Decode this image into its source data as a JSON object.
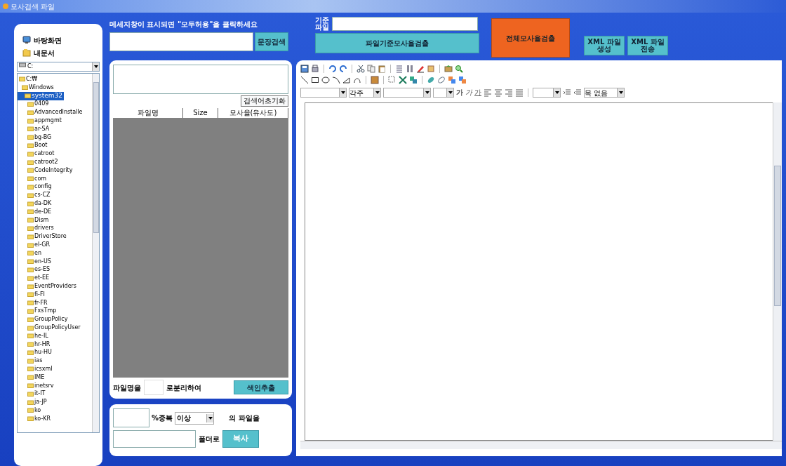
{
  "window": {
    "title": "모사검색 파일"
  },
  "shortcuts": [
    {
      "label": "바탕화면",
      "kind": "desktop"
    },
    {
      "label": "내문서",
      "kind": "documents"
    }
  ],
  "drive": {
    "value": "C:"
  },
  "tree": [
    {
      "label": "C:₩",
      "selected": false,
      "children": [
        {
          "label": "Windows",
          "selected": false,
          "children": [
            {
              "label": "system32",
              "selected": true,
              "children": [
                {
                  "label": "0409",
                  "selected": false
                },
                {
                  "label": "AdvancedInstalle",
                  "selected": false
                },
                {
                  "label": "appmgmt",
                  "selected": false
                },
                {
                  "label": "ar-SA",
                  "selected": false
                },
                {
                  "label": "bg-BG",
                  "selected": false
                },
                {
                  "label": "Boot",
                  "selected": false
                },
                {
                  "label": "catroot",
                  "selected": false
                },
                {
                  "label": "catroot2",
                  "selected": false
                },
                {
                  "label": "CodeIntegrity",
                  "selected": false
                },
                {
                  "label": "com",
                  "selected": false
                },
                {
                  "label": "config",
                  "selected": false
                },
                {
                  "label": "cs-CZ",
                  "selected": false
                },
                {
                  "label": "da-DK",
                  "selected": false
                },
                {
                  "label": "de-DE",
                  "selected": false
                },
                {
                  "label": "Dism",
                  "selected": false
                },
                {
                  "label": "drivers",
                  "selected": false
                },
                {
                  "label": "DriverStore",
                  "selected": false
                },
                {
                  "label": "el-GR",
                  "selected": false
                },
                {
                  "label": "en",
                  "selected": false
                },
                {
                  "label": "en-US",
                  "selected": false
                },
                {
                  "label": "es-ES",
                  "selected": false
                },
                {
                  "label": "et-EE",
                  "selected": false
                },
                {
                  "label": "EventProviders",
                  "selected": false
                },
                {
                  "label": "fi-FI",
                  "selected": false
                },
                {
                  "label": "fr-FR",
                  "selected": false
                },
                {
                  "label": "FxsTmp",
                  "selected": false
                },
                {
                  "label": "GroupPolicy",
                  "selected": false
                },
                {
                  "label": "GroupPolicyUser",
                  "selected": false
                },
                {
                  "label": "he-IL",
                  "selected": false
                },
                {
                  "label": "hr-HR",
                  "selected": false
                },
                {
                  "label": "hu-HU",
                  "selected": false
                },
                {
                  "label": "ias",
                  "selected": false
                },
                {
                  "label": "icsxml",
                  "selected": false
                },
                {
                  "label": "IME",
                  "selected": false
                },
                {
                  "label": "inetsrv",
                  "selected": false
                },
                {
                  "label": "it-IT",
                  "selected": false
                },
                {
                  "label": "ja-JP",
                  "selected": false
                },
                {
                  "label": "ko",
                  "selected": false
                },
                {
                  "label": "ko-KR",
                  "selected": false
                }
              ]
            }
          ]
        }
      ]
    }
  ],
  "notice": "메세지창이 표시되면 \"모두허용\"을 클릭하세요",
  "sentence_search": {
    "button": "문장검색"
  },
  "base_file": {
    "label": "기준파일"
  },
  "buttons": {
    "file_detect": "파일기준모사율검출",
    "all_detect": "전체모사율검출",
    "xml_create": "XML 파일 생성",
    "xml_send": "XML 파일 전송"
  },
  "results": {
    "reset_button": "검색어초기화",
    "columns": [
      "파일명",
      "Size",
      "모사율(유사도)"
    ]
  },
  "split": {
    "prefix": "파일명을",
    "suffix": "로분리하여",
    "button": "색인추출"
  },
  "copy": {
    "percent_label": "%중복",
    "comparison": "이상",
    "files_label": "의 파일을",
    "folder_label": "폴더로",
    "button": "복사"
  },
  "editor": {
    "font_style": "각주",
    "format_buttons": [
      "가",
      "가",
      "가"
    ],
    "style_select": "목 없음"
  }
}
